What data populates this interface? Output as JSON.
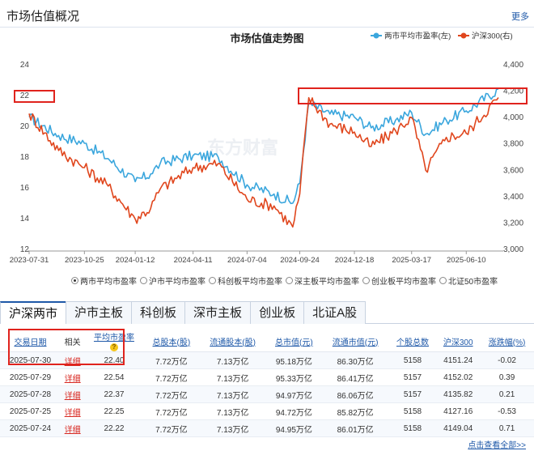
{
  "header": {
    "title": "市场估值概况",
    "more": "更多"
  },
  "chart": {
    "title": "市场估值走势图",
    "legend": [
      {
        "name": "两市平均市盈率(左)",
        "color": "#3aa6dd"
      },
      {
        "name": "沪深300(右)",
        "color": "#e0461d"
      }
    ],
    "watermark": "东方财富",
    "left_ticks": [
      "24",
      "22",
      "20",
      "18",
      "16",
      "14",
      "12"
    ],
    "right_ticks": [
      "4,400",
      "4,200",
      "4,000",
      "3,800",
      "3,600",
      "3,400",
      "3,200",
      "3,000"
    ],
    "x_ticks": [
      "2023-07-31",
      "2023-10-25",
      "2024-01-12",
      "2024-04-11",
      "2024-07-04",
      "2024-09-24",
      "2024-12-18",
      "2025-03-17",
      "2025-06-10"
    ]
  },
  "chart_data": {
    "type": "line",
    "title": "市场估值走势图",
    "x": [
      "2023-07-31",
      "2023-09-15",
      "2023-10-25",
      "2023-12-01",
      "2024-01-12",
      "2024-02-05",
      "2024-02-20",
      "2024-04-11",
      "2024-05-20",
      "2024-07-04",
      "2024-08-15",
      "2024-09-13",
      "2024-09-24",
      "2024-10-08",
      "2024-11-10",
      "2024-12-18",
      "2025-01-13",
      "2025-02-20",
      "2025-03-17",
      "2025-04-08",
      "2025-05-10",
      "2025-06-10",
      "2025-07-30"
    ],
    "series": [
      {
        "name": "两市平均市盈率(左)",
        "axis": "left",
        "values": [
          20.6,
          19.4,
          18.9,
          17.9,
          16.4,
          16.9,
          17.6,
          18.1,
          18.0,
          16.2,
          15.6,
          15.0,
          16.3,
          21.5,
          20.8,
          20.6,
          19.9,
          20.4,
          20.9,
          19.5,
          20.4,
          21.0,
          22.4
        ]
      },
      {
        "name": "沪深300(右)",
        "axis": "right",
        "values": [
          4030,
          3750,
          3620,
          3480,
          3230,
          3310,
          3460,
          3620,
          3650,
          3380,
          3330,
          3170,
          3420,
          4150,
          3950,
          3890,
          3780,
          3900,
          4000,
          3600,
          3850,
          3880,
          4151.24
        ]
      }
    ],
    "ylim_left": [
      12,
      24
    ],
    "ylim_right": [
      3000,
      4400
    ],
    "legend": "top-right",
    "grid": false
  },
  "radios": [
    {
      "label": "两市平均市盈率",
      "checked": true
    },
    {
      "label": "沪市平均市盈率",
      "checked": false
    },
    {
      "label": "科创板平均市盈率",
      "checked": false
    },
    {
      "label": "深主板平均市盈率",
      "checked": false
    },
    {
      "label": "创业板平均市盈率",
      "checked": false
    },
    {
      "label": "北证50市盈率",
      "checked": false
    }
  ],
  "tabs": [
    "沪深两市",
    "沪市主板",
    "科创板",
    "深市主板",
    "创业板",
    "北证A股"
  ],
  "table": {
    "headers": [
      "交易日期",
      "相关",
      "平均市盈率",
      "总股本(股)",
      "流通股本(股)",
      "总市值(元)",
      "流通市值(元)",
      "个股总数",
      "沪深300",
      "涨跌幅(%)"
    ],
    "rows": [
      [
        "2025-07-30",
        "详细",
        "22.40",
        "7.72万亿",
        "7.13万亿",
        "95.18万亿",
        "86.30万亿",
        "5158",
        "4151.24",
        "-0.02"
      ],
      [
        "2025-07-29",
        "详细",
        "22.54",
        "7.72万亿",
        "7.13万亿",
        "95.33万亿",
        "86.41万亿",
        "5157",
        "4152.02",
        "0.39"
      ],
      [
        "2025-07-28",
        "详细",
        "22.37",
        "7.72万亿",
        "7.13万亿",
        "94.97万亿",
        "86.06万亿",
        "5157",
        "4135.82",
        "0.21"
      ],
      [
        "2025-07-25",
        "详细",
        "22.25",
        "7.72万亿",
        "7.13万亿",
        "94.72万亿",
        "85.82万亿",
        "5158",
        "4127.16",
        "-0.53"
      ],
      [
        "2025-07-24",
        "详细",
        "22.22",
        "7.72万亿",
        "7.13万亿",
        "94.95万亿",
        "86.01万亿",
        "5158",
        "4149.04",
        "0.71"
      ]
    ]
  },
  "footer": {
    "link": "点击查看全部>>"
  }
}
